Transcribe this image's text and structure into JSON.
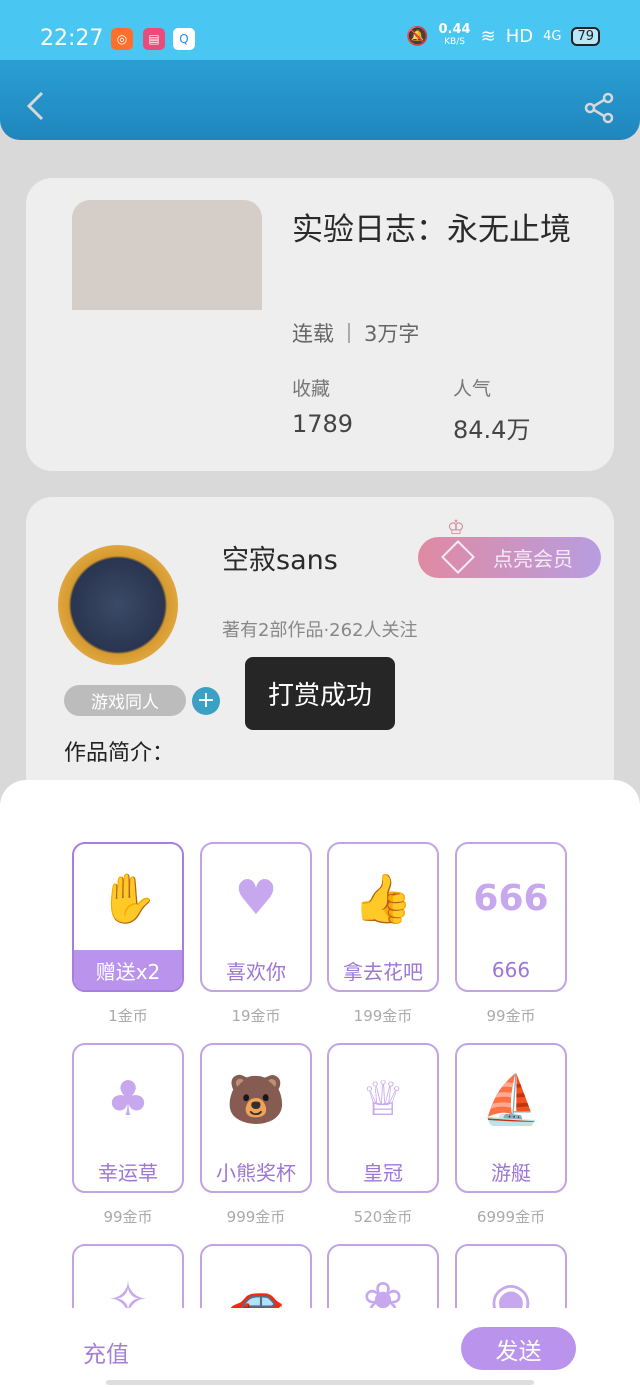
{
  "status_bar": {
    "time": "22:27",
    "net_speed": "0.44",
    "net_unit": "KB/S",
    "hd": "HD",
    "network": "4G",
    "battery": "79"
  },
  "book": {
    "title": "实验日志：永无止境",
    "status": "连载",
    "words": "3万字",
    "fav_label": "收藏",
    "fav_value": "1789",
    "pop_label": "人气",
    "pop_value": "84.4万"
  },
  "author": {
    "name": "空寂sans",
    "info": "著有2部作品·262人关注",
    "vip_button": "点亮会员",
    "tag": "游戏同人",
    "intro_label": "作品简介："
  },
  "toast": "打赏成功",
  "gifts": [
    {
      "name": "赠送x2",
      "price": "1金币",
      "icon": "wave-hand-icon"
    },
    {
      "name": "喜欢你",
      "price": "19金币",
      "icon": "heart-hand-icon"
    },
    {
      "name": "拿去花吧",
      "price": "199金币",
      "icon": "thumbs-up-coin-icon"
    },
    {
      "name": "666",
      "price": "99金币",
      "icon": "666-bubble-icon"
    },
    {
      "name": "幸运草",
      "price": "99金币",
      "icon": "clover-icon"
    },
    {
      "name": "小熊奖杯",
      "price": "999金币",
      "icon": "bear-cup-icon"
    },
    {
      "name": "皇冠",
      "price": "520金币",
      "icon": "crown-icon"
    },
    {
      "name": "游艇",
      "price": "6999金币",
      "icon": "yacht-icon"
    }
  ],
  "footer": {
    "recharge": "充值",
    "send": "发送"
  },
  "colors": {
    "accent": "#b993ec",
    "topbar": "#1f86bd",
    "statusbar": "#49c6f2"
  }
}
